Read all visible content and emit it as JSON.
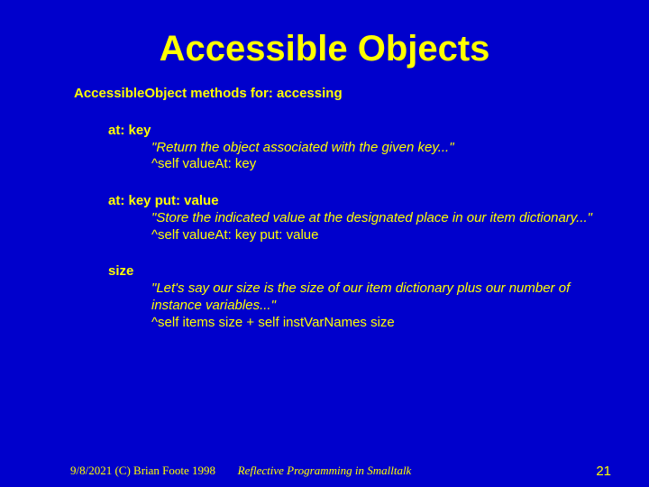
{
  "title": "Accessible Objects",
  "section_header": "AccessibleObject methods for:  accessing",
  "methods": [
    {
      "signature": "at: key",
      "comment": "\"Return the object associated with the given key...\"",
      "code": "^self valueAt: key"
    },
    {
      "signature": "at: key put: value",
      "comment": "\"Store the indicated value at the designated place in our item dictionary...\"",
      "code": "^self valueAt: key put: value"
    },
    {
      "signature": "size",
      "comment": "\"Let's say our size is the size of our item dictionary plus our number of instance variables...\"",
      "code": "^self items size + self instVarNames size"
    }
  ],
  "footer": {
    "left": "9/8/2021 (C) Brian Foote 1998",
    "center": "Reflective Programming in Smalltalk",
    "right": "21"
  }
}
